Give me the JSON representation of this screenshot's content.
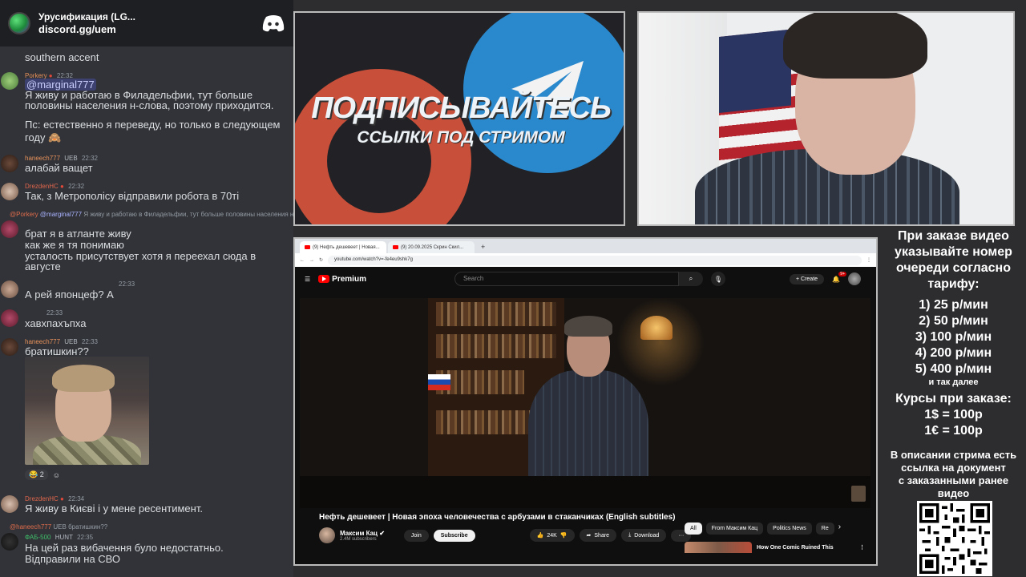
{
  "discord": {
    "server_name": "Урусификация (LG...",
    "invite": "discord.gg/uem"
  },
  "chat": {
    "m0": {
      "line1": "southern accent"
    },
    "m1": {
      "user": "Porkery",
      "time": "22:32",
      "mention": "@marginal777",
      "line1": "Я живу и работаю в Филадельфии, тут больше",
      "line2": "половины населения н-слова, поэтому приходится.",
      "line3": "Пс: естественно я переведу, но только в следующем",
      "line4": "году 🙈"
    },
    "m2": {
      "user": "haneech777",
      "tag": "UEB",
      "time": "22:32",
      "line1": "алабай ващет"
    },
    "m3": {
      "user": "DrezdenHC",
      "time": "22:32",
      "line1": "Так, з Метрополісу відправили робота в 70ті"
    },
    "m4": {
      "reply_user": "@Porkery",
      "reply_mention": "@marginal777",
      "reply_text": "Я живу и работаю в Филадельфии, тут больше половины населения н-",
      "line1": "брат я в атланте живу",
      "line2": "как же я тя понимаю",
      "line3": "усталость присутствует хотя я переехал сюда в",
      "line4": "августе"
    },
    "m5": {
      "time": "22:33",
      "line1": "А рей японцеф? А"
    },
    "m6": {
      "time": "22:33",
      "line1": "хавхпахъпха"
    },
    "m7": {
      "user": "haneech777",
      "tag": "UEB",
      "time": "22:33",
      "line1": "братишкин??",
      "reaction_count": "2"
    },
    "m8": {
      "user": "DrezdenHC",
      "time": "22:34",
      "line1": "Я живу в Києві і у мене ресентимент."
    },
    "m9": {
      "reply_user": "@haneech777",
      "reply_tag": "UEB",
      "reply_text": "братишкин??",
      "user": "ФАБ-500",
      "tag": "HUNT",
      "time": "22:35",
      "line1": "На цей раз вибачення було недостатньо.",
      "line2": "Відправили на СВО"
    }
  },
  "banner": {
    "title": "ПОДПИСЫВАЙТЕСЬ",
    "subtitle": "ССЫЛКИ ПОД СТРИМОМ"
  },
  "browser": {
    "tab1": "(9) Нефть дешевеет | Новая...",
    "tab2": "(9) 20.09.2025 Скрин Скил...",
    "url": "youtube.com/watch?v=-fe4eu9shk7g",
    "yt_brand": "Premium",
    "search_placeholder": "Search",
    "create_label": "Create",
    "notif_badge": "9+",
    "video_title": "Нефть дешевеет | Новая эпоха человечества с арбузами в стаканчиках (English subtitles)",
    "channel_name": "Максим Кац",
    "subscribers": "2.4M subscribers",
    "join_label": "Join",
    "subscribe_label": "Subscribe",
    "likes": "24K",
    "share_label": "Share",
    "download_label": "Download",
    "chips": [
      "All",
      "From Максим Кац",
      "Politics News",
      "Re"
    ],
    "side_video_title": "How One Comic Ruined This"
  },
  "info": {
    "heading": [
      "При заказе видео",
      "указывайте номер",
      "очереди согласно",
      "тарифу:"
    ],
    "tariffs": [
      "1) 25 р/мин",
      "2) 50 р/мин",
      "3) 100 р/мин",
      "4) 200 р/мин",
      "5) 400 р/мин"
    ],
    "etc": "и так далее",
    "rates_title": "Курсы при заказе:",
    "rates": [
      "1$ = 100р",
      "1€ = 100р"
    ],
    "desc": [
      "В описании стрима есть",
      "ссылка на документ",
      "с заказанными ранее",
      "видео"
    ]
  },
  "colors": {
    "discord_bg": "#313338",
    "youtube_red": "#ff0000",
    "username_orange": "#e8915a",
    "username_red": "#e0654b"
  }
}
